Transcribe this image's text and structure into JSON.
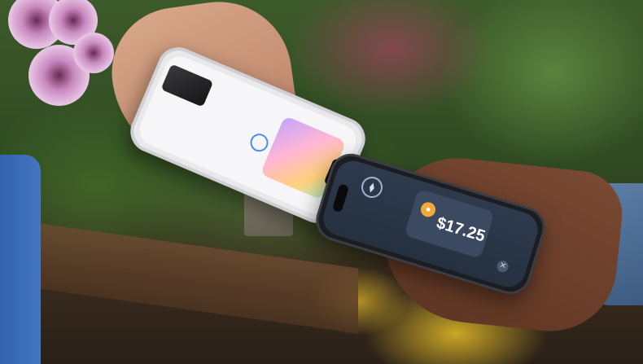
{
  "photo": {
    "subject": "",
    "colors": {
      "background_green": "#3d5a2a",
      "flower_pink": "#c98ac0",
      "flower_yellow": "#e6be28",
      "sleeve_left": "#2f5ea8",
      "sleeve_right": "#5e7fa6"
    }
  },
  "phone_bottom": {
    "amount": "$17.25",
    "icons": [
      "nfc-icon",
      "coin-icon",
      "close-icon"
    ]
  },
  "phone_top": {
    "icons": [
      "ready-icon"
    ]
  }
}
